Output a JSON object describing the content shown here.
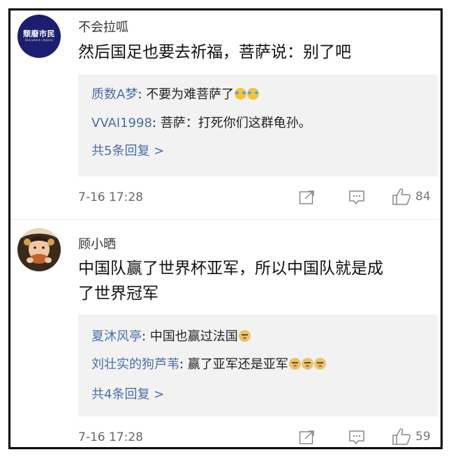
{
  "comments": [
    {
      "avatar_text": "颓廢市民",
      "avatar_subtext": "Decadent citizens",
      "username": "不会拉呱",
      "content": "然后国足也要去祈福，菩萨说：别了吧",
      "replies": [
        {
          "user": "质数A梦",
          "text": ": 不要为难菩萨了",
          "emojis": [
            "laugh-cry-icon",
            "laugh-cry-icon"
          ]
        },
        {
          "user": "VVAI1998",
          "text": ": 菩萨：打死你们这群龟孙。",
          "emojis": []
        }
      ],
      "more_replies": "共5条回复 >",
      "time": "7-16 17:28",
      "like_count": "84"
    },
    {
      "username": "顾小晒",
      "content_line1": "中国队赢了世界杯亚军，所以中国队就是成",
      "content_line2": "了世界冠军",
      "replies": [
        {
          "user": "夏沐风亭",
          "text": ": 中国也赢过法国",
          "emojis": [
            "doge-icon"
          ]
        },
        {
          "user": "刘壮实的狗芦苇",
          "text": ": 赢了亚军还是亚军",
          "emojis": [
            "doge-icon",
            "doge-icon",
            "doge-icon"
          ]
        }
      ],
      "more_replies": "共4条回复 >",
      "time": "7-16 17:28",
      "like_count": "59"
    }
  ]
}
